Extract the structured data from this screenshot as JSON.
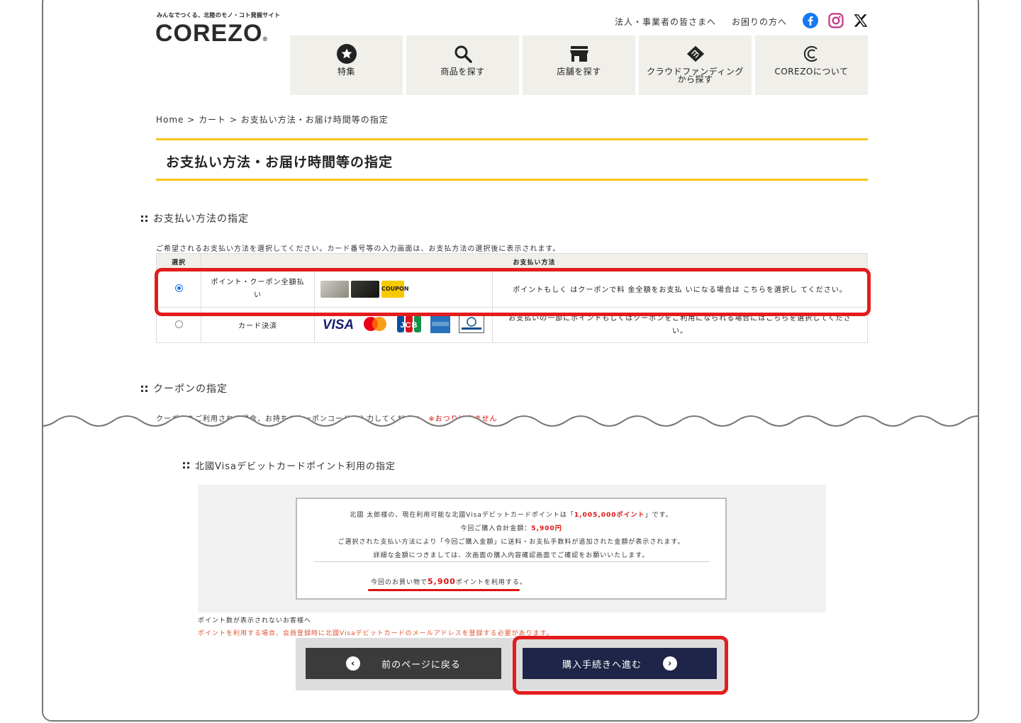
{
  "header": {
    "logo_tagline": "みんなでつくる、北陸のモノ・コト発掘サイト",
    "logo_text": "COREZO",
    "logo_reg": "®",
    "links": [
      "法人・事業者の皆さまへ",
      "お困りの方へ"
    ],
    "nav": [
      {
        "label": "特集",
        "icon": "star-icon"
      },
      {
        "label": "商品を探す",
        "icon": "search-icon"
      },
      {
        "label": "店舗を探す",
        "icon": "store-icon"
      },
      {
        "label": "クラウドファンディング\nから探す",
        "label_line1": "クラウドファンディング",
        "label_line2": "から探す",
        "icon": "handshake-icon"
      },
      {
        "label": "COREZOについて",
        "icon": "corezo-c-icon"
      }
    ]
  },
  "breadcrumb": "Home > カート > お支払い方法・お届け時間等の指定",
  "page_title": "お支払い方法・お届け時間等の指定",
  "payment_section": {
    "heading": "お支払い方法の指定",
    "instruction": "ご希望されるお支払い方法を選択してください。カード番号等の入力画面は、お支払方法の選択後に表示されます。",
    "col_select": "選択",
    "col_method": "お支払い方法",
    "rows": [
      {
        "name": "ポイント・クーポン全額払い",
        "name_line1": "ポイント・クーポン全額払",
        "name_line2": "い",
        "selected": true,
        "coupon_label": "COUPON",
        "desc": "ポイントもしく はクーポンで料 金全額をお支払 いになる場合は こちらを選択し てください。"
      },
      {
        "name": "カード決済",
        "selected": false,
        "card_brands": [
          "VISA",
          "Mastercard",
          "JCB",
          "AMEX",
          "Diners Club"
        ],
        "desc_line1": "お支払いの一部にポイントもしくはクーポンをご利用になられる場合にはこちらを選択してくださ",
        "desc_line2": "い。"
      }
    ]
  },
  "coupon_section": {
    "heading": "クーポンの指定",
    "instruction": "クーポンをご利用される場合、お持ちのクーポンコードを入力してください。",
    "note": "※おつりは出ません"
  },
  "point_section": {
    "heading": "北國Visaデビットカードポイント利用の指定",
    "line1_pre": "北國 太郎様の、現在利用可能な北國Visaデビットカードポイントは「",
    "line1_points": "1,005,000ポイント",
    "line1_post": "」です。",
    "line2_pre": "今回ご購入合計金額：",
    "line2_amount": "5,900円",
    "line3": "ご選択された支払い方法により「今回ご購入金額」に送料・お支払手数料が追加された金額が表示されます。",
    "line4": "詳細な金額につきましては、次画面の購入内容確認画面でご確認をお願いいたします。",
    "use_pre": "今回のお買い物で",
    "use_points": "5,900",
    "use_post": "ポイントを利用する。",
    "note1": "ポイント数が表示されないお客様へ",
    "note2": "ポイントを利用する場合、会員登録時に北國Visaデビットカードのメールアドレスを登録する必要があります。"
  },
  "buttons": {
    "back": "前のページに戻る",
    "next": "購入手続きへ進む"
  },
  "colors": {
    "accent_yellow": "#f5c518",
    "highlight_red": "#e31d1d",
    "next_button": "#1e2548",
    "back_button": "#3b3b3b"
  }
}
